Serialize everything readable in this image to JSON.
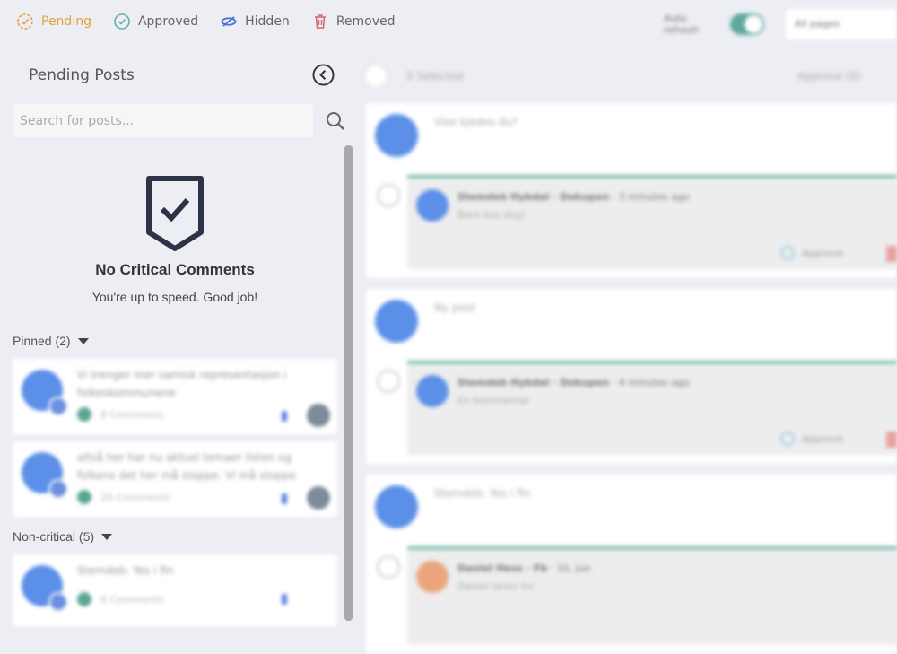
{
  "tabs": [
    {
      "label": "Pending",
      "icon": "pending-clock-icon",
      "color": "#e3a33d",
      "active": true
    },
    {
      "label": "Approved",
      "icon": "check-circle-icon",
      "color": "#5fb3a5"
    },
    {
      "label": "Hidden",
      "icon": "eye-off-icon",
      "color": "#4a73d6"
    },
    {
      "label": "Removed",
      "icon": "trash-icon",
      "color": "#d9646a"
    }
  ],
  "topbar": {
    "auto_refresh_label": "Auto refresh",
    "auto_refresh_on": true,
    "page_select": "All pages"
  },
  "left": {
    "title": "Pending Posts",
    "search_placeholder": "Search for posts...",
    "empty_title": "No Critical Comments",
    "empty_text": "You're up to speed. Good job!",
    "pinned_label": "Pinned (2)",
    "noncritical_label": "Non-critical (5)",
    "pinned": [
      {
        "text": "Vi trenger mer samisk representasjon i folkeskommunene",
        "comments": "8 Comments"
      },
      {
        "text": "altså her har nu aktuel temaer listen og folkens det her må stoppe. Vi må stoppe",
        "comments": "26 Comments"
      }
    ],
    "noncritical": [
      {
        "text": "Stemdeb: Yes i fin",
        "comments": "6 Comments"
      }
    ]
  },
  "right": {
    "selected": "0 Selected",
    "approve_all": "Approve (0)",
    "posts": [
      {
        "text": "Vise kjedes du?",
        "commenter": "Stemdeb Hybdal · Dokupen",
        "time": "3 minutes ago",
        "comment": "Bare kos deg!",
        "approve": "Approve"
      },
      {
        "text": "Ny post",
        "commenter": "Stemdeb Hybdal · Dokupen",
        "time": "4 minutes ago",
        "comment": "En kommentar",
        "approve": "Approve"
      },
      {
        "text": "Stemdeb: Yes i fin",
        "commenter": "Daniel Hess · Fb",
        "time": "1h, jun",
        "comment": "Daniel skrev hv"
      }
    ]
  }
}
